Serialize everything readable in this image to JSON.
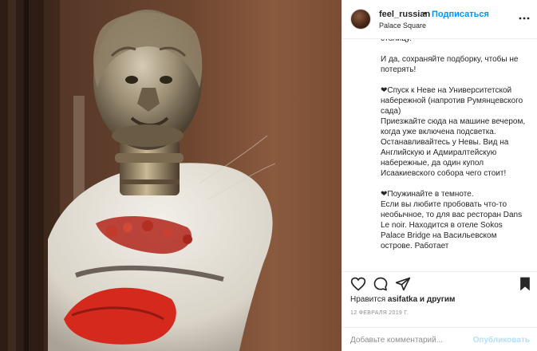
{
  "post": {
    "username": "feel_russian",
    "separator": "•",
    "follow_label": "Подписаться",
    "location": "Palace Square"
  },
  "caption": {
    "text": "столицу.\n\nИ да, сохраняйте подборку, чтобы не потерять!\n\n❤Спуск к Неве на Университетской набережной (напротив Румянцевского сада)\nПриезжайте сюда на машине вечером, когда уже включена подсветка. Останавливайтесь у Невы. Вид на Английскую и Адмиралтейскую набережные, да один купол Исаакиевского собора чего стоит!\n\n❤Поужинайте в темноте.\nЕсли вы любите пробовать что-то необычное, то для вас ресторан Dans Le noir. Находится в отеле Sokos Palace Bridge на Васильевском острове. Работает"
  },
  "likes": {
    "prefix": "Нравится ",
    "user": "asifatka",
    "suffix": " и другим"
  },
  "date": "12 ФЕВРАЛЯ 2019 Г.",
  "comment": {
    "placeholder": "Добавьте комментарий...",
    "post_label": "Опубликовать"
  },
  "icons": {
    "more": "more-options-icon",
    "like": "heart-icon",
    "comment": "comment-icon",
    "share": "share-icon",
    "save": "bookmark-icon"
  },
  "colors": {
    "accent": "#0095f6",
    "post_disabled": "#b2dffc",
    "border": "#efefef",
    "muted": "#8e8e8e",
    "text": "#262626"
  }
}
